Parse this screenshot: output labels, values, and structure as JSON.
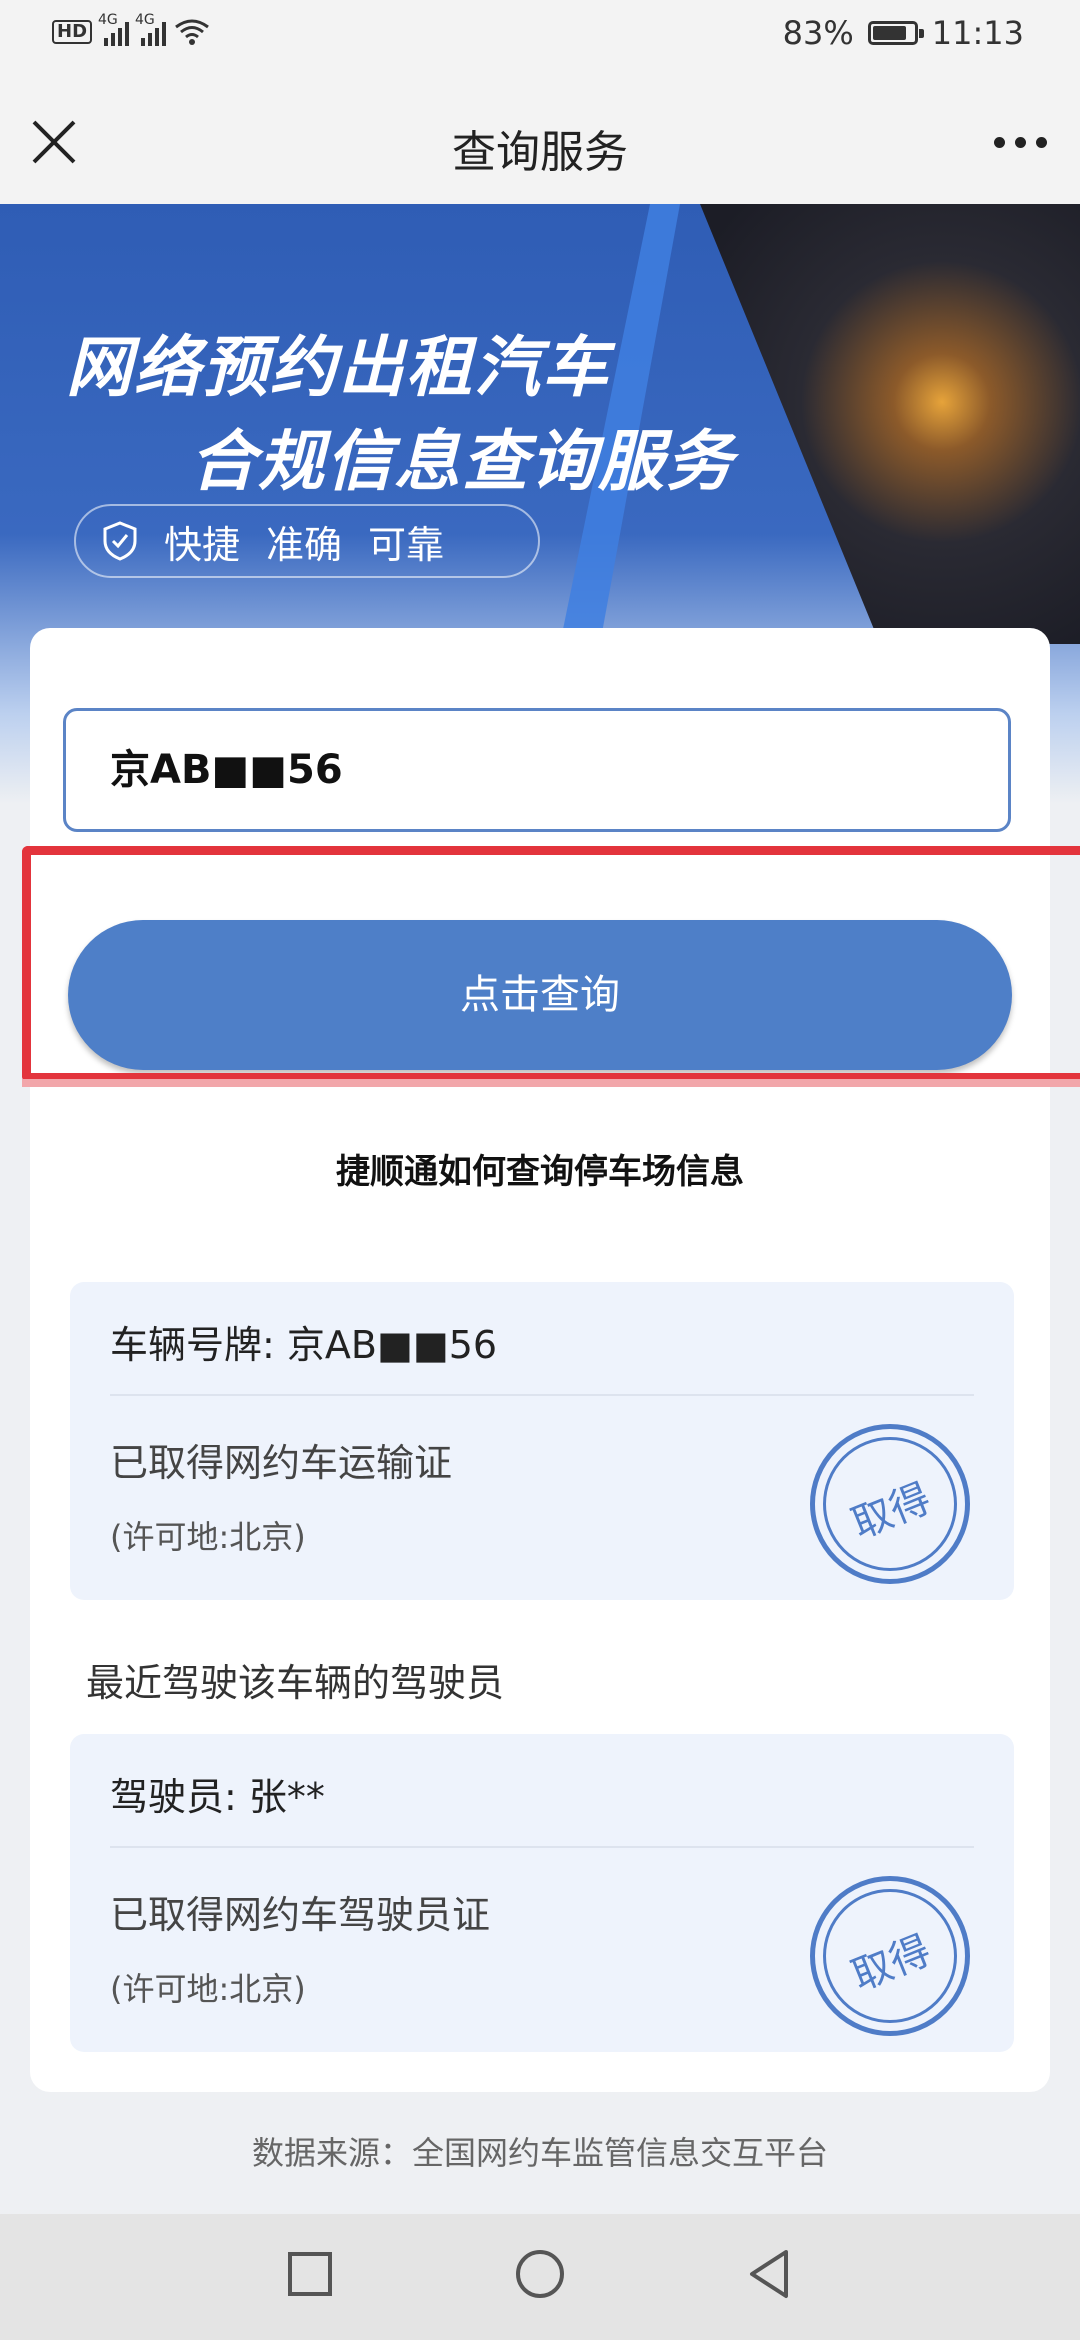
{
  "status_bar": {
    "hd": "HD",
    "signal1": "4G",
    "signal2": "4G",
    "battery": "83%",
    "battery_level": 0.83,
    "time": "11:13"
  },
  "nav": {
    "title": "查询服务"
  },
  "banner": {
    "title_line1": "网络预约出租汽车",
    "title_line2": "合规信息查询服务",
    "tags": [
      "快捷",
      "准确",
      "可靠"
    ]
  },
  "search": {
    "plate_value": "京AB■■56",
    "button_label": "点击查询"
  },
  "caption": "捷顺通如何查询停车场信息",
  "vehicle_card": {
    "plate_line": "车辆号牌: 京AB■■56",
    "status": "已取得网约车运输证",
    "permit_place": "(许可地:北京)",
    "stamp": "取得"
  },
  "drivers_section_label": "最近驾驶该车辆的驾驶员",
  "driver_card": {
    "driver_line": "驾驶员: 张**",
    "status": "已取得网约车驾驶员证",
    "permit_place": "(许可地:北京)",
    "stamp": "取得"
  },
  "footer": {
    "source": "数据来源：全国网约车监管信息交互平台"
  },
  "colors": {
    "primary": "#4e7fc8",
    "highlight": "#e3343c",
    "card_bg": "#eef3fc"
  }
}
